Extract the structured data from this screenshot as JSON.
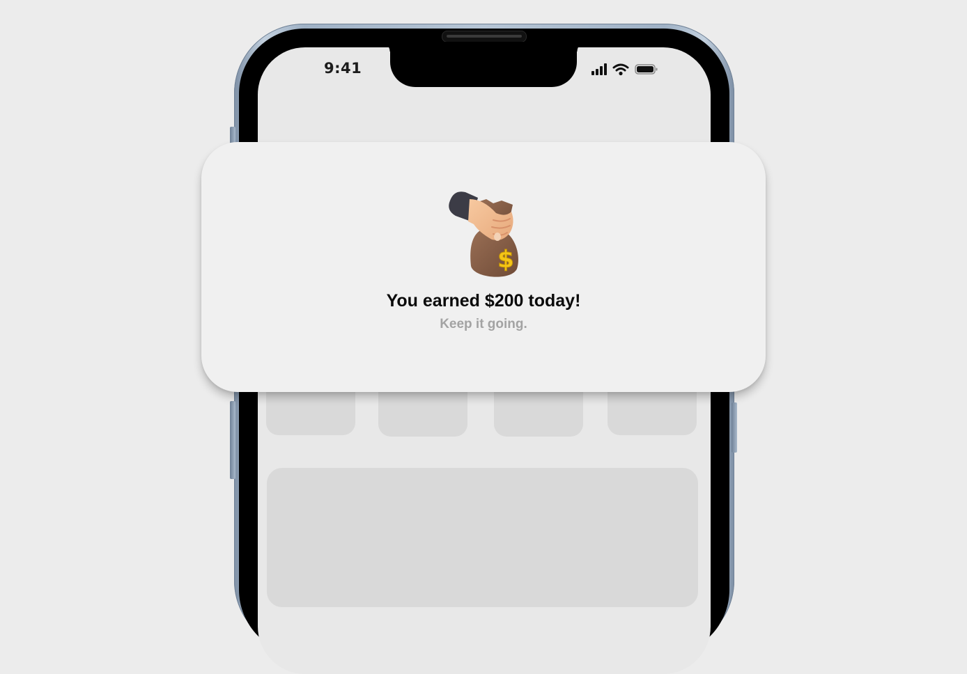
{
  "status_bar": {
    "time": "9:41",
    "icons": [
      "cellular-signal-icon",
      "wifi-icon",
      "battery-icon"
    ]
  },
  "notification": {
    "icon": "money-bag-icon",
    "title": "You earned $200 today!",
    "subtitle": "Keep it going."
  },
  "colors": {
    "background": "#ececec",
    "card": "#f0f0f0",
    "screen": "#e8e8e8",
    "placeholder": "#d9d9d9",
    "title": "#0a0a0a",
    "subtitle": "#a3a3a3",
    "bag": "#8a6248",
    "dollar": "#f5c518"
  }
}
